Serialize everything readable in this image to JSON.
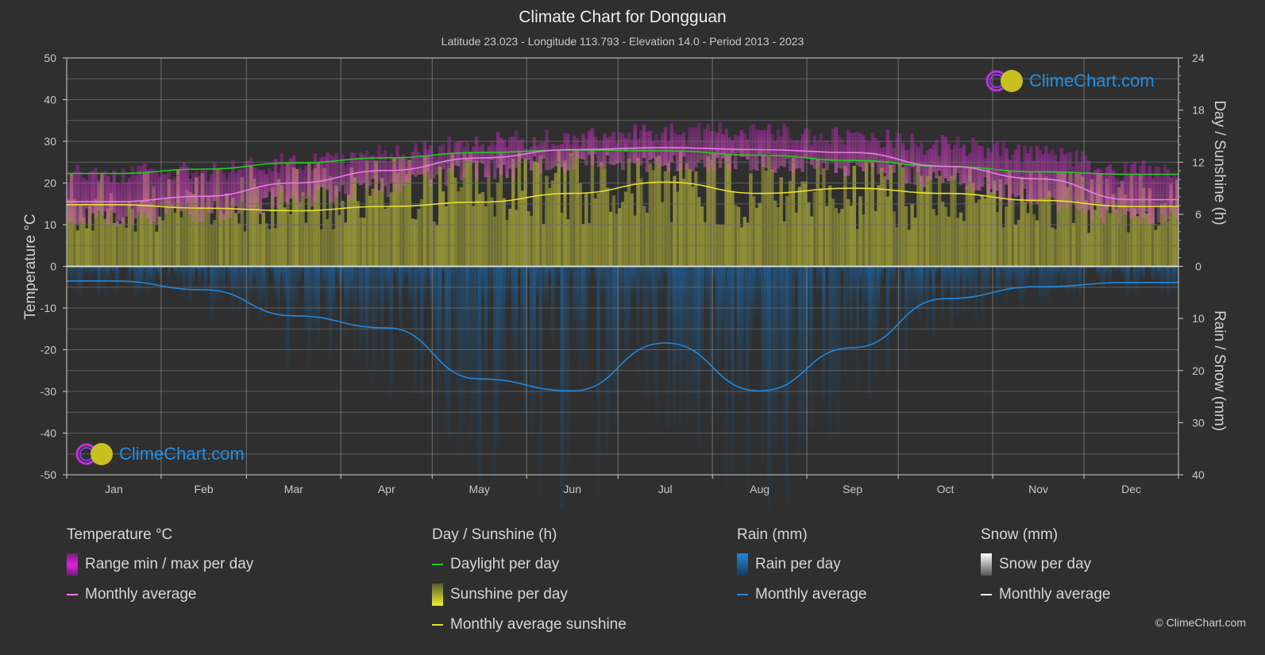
{
  "header": {
    "title": "Climate Chart for Dongguan",
    "subtitle": "Latitude 23.023 - Longitude 113.793 - Elevation 14.0 - Period 2013 - 2023"
  },
  "logo_text": "ClimeChart.com",
  "copyright": "© ClimeChart.com",
  "chart_data": {
    "type": "line",
    "title": "Climate Chart for Dongguan",
    "categories": [
      "Jan",
      "Feb",
      "Mar",
      "Apr",
      "May",
      "Jun",
      "Jul",
      "Aug",
      "Sep",
      "Oct",
      "Nov",
      "Dec"
    ],
    "axes": {
      "left": {
        "label": "Temperature °C",
        "range": [
          -50,
          50
        ],
        "ticks": [
          "50",
          "40",
          "30",
          "20",
          "10",
          "0",
          "-10",
          "-20",
          "-30",
          "-40",
          "-50"
        ]
      },
      "right_top": {
        "label": "Day / Sunshine (h)",
        "range": [
          0,
          24
        ],
        "ticks": [
          "24",
          "18",
          "12",
          "6",
          "0"
        ]
      },
      "right_bottom": {
        "label": "Rain / Snow (mm)",
        "range": [
          0,
          40
        ],
        "ticks": [
          "0",
          "10",
          "20",
          "30",
          "40"
        ]
      }
    },
    "grid": true,
    "series": [
      {
        "name": "Temperature monthly average",
        "unit": "°C",
        "color": "#ee77ee",
        "values": [
          15.5,
          16.8,
          20.0,
          23.0,
          26.0,
          28.0,
          28.5,
          28.0,
          27.3,
          24.0,
          21.0,
          16.0
        ]
      },
      {
        "name": "Daylight per day",
        "unit": "h",
        "color": "#22cc22",
        "values": [
          10.7,
          11.2,
          11.9,
          12.5,
          13.1,
          13.4,
          13.3,
          12.8,
          12.2,
          11.5,
          10.9,
          10.6
        ]
      },
      {
        "name": "Monthly average sunshine",
        "unit": "h",
        "color": "#e8e030",
        "values": [
          7.1,
          6.7,
          6.4,
          6.9,
          7.4,
          8.4,
          9.7,
          8.4,
          9.0,
          8.4,
          7.6,
          6.9
        ]
      },
      {
        "name": "Rain monthly average",
        "unit": "mm",
        "color": "#1e88e0",
        "values": [
          2.8,
          4.5,
          9.5,
          11.8,
          21.6,
          23.9,
          14.7,
          23.9,
          15.6,
          6.2,
          3.9,
          3.1
        ]
      },
      {
        "name": "Temperature range max (approx)",
        "unit": "°C",
        "values": [
          22,
          23,
          25,
          27,
          30,
          31,
          32,
          32,
          31,
          29,
          27,
          23
        ]
      },
      {
        "name": "Temperature range min (approx)",
        "unit": "°C",
        "values": [
          12,
          13,
          16,
          19,
          23,
          25,
          25,
          25,
          24,
          21,
          16,
          12
        ]
      },
      {
        "name": "Snow monthly average",
        "unit": "mm",
        "color": "#ffffff",
        "values": [
          0,
          0,
          0,
          0,
          0,
          0,
          0,
          0,
          0,
          0,
          0,
          0
        ]
      }
    ]
  },
  "legend": {
    "temperature": {
      "heading": "Temperature °C",
      "items": [
        {
          "label": "Range min / max per day"
        },
        {
          "label": "Monthly average"
        }
      ]
    },
    "sunshine": {
      "heading": "Day / Sunshine (h)",
      "items": [
        {
          "label": "Daylight per day"
        },
        {
          "label": "Sunshine per day"
        },
        {
          "label": "Monthly average sunshine"
        }
      ]
    },
    "rain": {
      "heading": "Rain (mm)",
      "items": [
        {
          "label": "Rain per day"
        },
        {
          "label": "Monthly average"
        }
      ]
    },
    "snow": {
      "heading": "Snow (mm)",
      "items": [
        {
          "label": "Snow per day"
        },
        {
          "label": "Monthly average"
        }
      ]
    }
  }
}
